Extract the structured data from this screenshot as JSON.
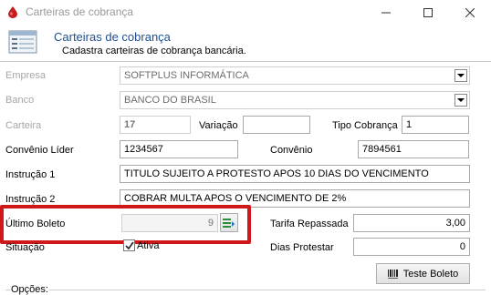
{
  "window": {
    "title": "Carteiras de cobrança",
    "icons": {
      "app": "blood-drop-icon",
      "minimize": "minimize-icon",
      "maximize": "maximize-icon",
      "close": "close-icon"
    }
  },
  "header": {
    "title": "Carteiras de cobrança",
    "subtitle": "Cadastra carteiras de cobrança bancária.",
    "icon": "form-window-icon"
  },
  "form": {
    "empresa": {
      "label": "Empresa",
      "value": "SOFTPLUS INFORMÁTICA"
    },
    "banco": {
      "label": "Banco",
      "value": "BANCO DO BRASIL"
    },
    "carteira": {
      "label": "Carteira",
      "value": "17"
    },
    "variacao": {
      "label": "Variação",
      "value": ""
    },
    "tipo_cobranca": {
      "label": "Tipo Cobrança",
      "value": "1"
    },
    "convenio_lider": {
      "label": "Convênio Líder",
      "value": "1234567"
    },
    "convenio": {
      "label": "Convênio",
      "value": "7894561"
    },
    "instrucao1": {
      "label": "Instrução 1",
      "value": "TITULO SUJEITO A PROTESTO APOS 10 DIAS DO VENCIMENTO"
    },
    "instrucao2": {
      "label": "Instrução 2",
      "value": "COBRAR MULTA APOS O VENCIMENTO DE 2%"
    },
    "ultimo_boleto": {
      "label": "Último Boleto",
      "value": "9",
      "button_icon": "list-edit-icon"
    },
    "tarifa_repassada": {
      "label": "Tarifa Repassada",
      "value": "3,00"
    },
    "situacao": {
      "label": "Situação",
      "checkbox_label": "Ativa",
      "checked": true
    },
    "dias_protestar": {
      "label": "Dias Protestar",
      "value": "0"
    },
    "teste_boleto": {
      "label": "Teste Boleto",
      "icon": "barcode-icon"
    }
  },
  "opcoes": {
    "label": "Opções:"
  },
  "highlight_color": "#d0181b"
}
